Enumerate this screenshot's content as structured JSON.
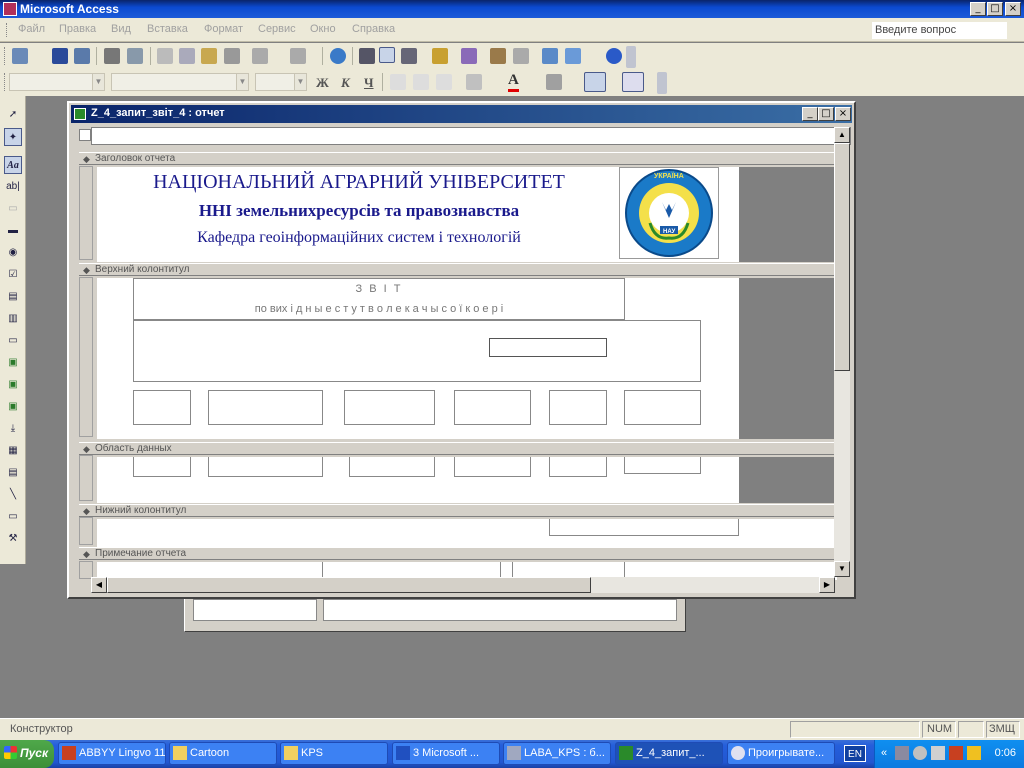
{
  "app": {
    "title": "Microsoft Access",
    "ask_placeholder": "Введите вопрос"
  },
  "window_controls": {
    "minimize": "_",
    "maximize": "□",
    "close": "×"
  },
  "menu": [
    "Файл",
    "Правка",
    "Вид",
    "Вставка",
    "Формат",
    "Сервис",
    "Окно",
    "Справка"
  ],
  "format_toolbar": {
    "bold": "Ж",
    "italic": "К",
    "underline": "Ч",
    "font_color_letter": "A"
  },
  "toolbox_glyphs": {
    "label": "Aa",
    "textbox": "ab|",
    "checkbox": "☑"
  },
  "report": {
    "window_title": "Z_4_запит_звіт_4 : отчет",
    "sections": {
      "header": "Заголовок отчета",
      "page_header": "Верхний колонтитул",
      "detail": "Область данных",
      "page_footer": "Нижний колонтитул",
      "footer": "Примечание отчета"
    },
    "title_lines": [
      "НАЦІОНАЛЬНИЙ АГРАРНИЙ УНІВЕРСИТЕТ",
      "ННІ земельнихресурсів та правознавства",
      "Кафедра геоінформаційних систем і технологій"
    ],
    "logo": {
      "top_text": "УКРАЇНА",
      "bottom_text": "НАЦІОНАЛЬНИЙ АГРАРНИЙ УНІВЕРСИТЕТ",
      "badge": "НАУ"
    },
    "page_header_line1": "З В І Т",
    "page_header_line2": "по вих і д н ы  е с т у т в о л е к а  ч ы с о ї  к о  е р і"
  },
  "status": {
    "mode": "Конструктор",
    "num": "NUM",
    "zmsh": "ЗМЩ"
  },
  "taskbar": {
    "start": "Пуск",
    "buttons": [
      "ABBYY Lingvo 11",
      "Cartoon",
      "KPS",
      "3 Microsoft ...",
      "LABA_KPS : б...",
      "Z_4_запит_...",
      "Проигрывате..."
    ],
    "lang": "EN",
    "clock": "0:06"
  },
  "colors": {
    "accent": "#0a246a",
    "report_text": "#1a1a8c"
  }
}
